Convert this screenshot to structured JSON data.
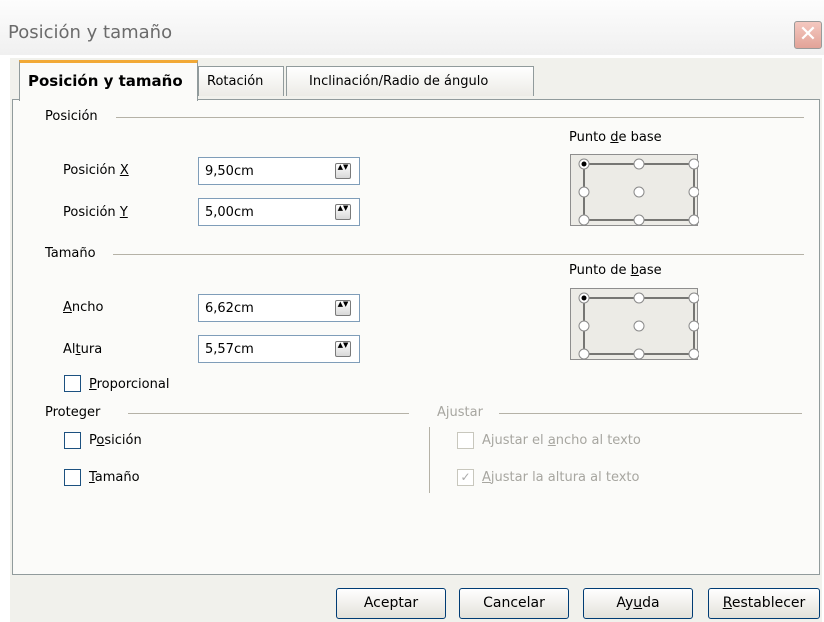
{
  "window": {
    "title": "Posición y tamaño",
    "close_symbol": "✕"
  },
  "tabs": [
    {
      "label": "Posición y tamaño",
      "active": true
    },
    {
      "label": "Rotación",
      "active": false
    },
    {
      "label": "Inclinación/Radio de ángulo",
      "active": false
    }
  ],
  "position": {
    "section_label": "Posición",
    "x_label": "Posición ",
    "x_mnemonic": "X",
    "x_value": "9,50cm",
    "y_label": "Posición ",
    "y_mnemonic": "Y",
    "y_value": "5,00cm",
    "base_point_pre": "Punto ",
    "base_point_mnemonic": "d",
    "base_point_post": "e base",
    "base_point_selected": "top-left"
  },
  "size": {
    "section_label": "Tamaño",
    "width_mnemonic": "A",
    "width_label_rest": "ncho",
    "width_value": "6,62cm",
    "height_pre": "Al",
    "height_mnemonic": "t",
    "height_post": "ura",
    "height_value": "5,57cm",
    "base_point_pre": "Punto de ",
    "base_point_mnemonic": "b",
    "base_point_post": "ase",
    "base_point_selected": "top-left",
    "proportional_mnemonic": "P",
    "proportional_rest": "roporcional",
    "proportional_checked": false
  },
  "protect": {
    "section_label": "Proteger",
    "position_pre": "P",
    "position_mnemonic": "o",
    "position_post": "sición",
    "position_checked": false,
    "size_mnemonic": "T",
    "size_rest": "amaño",
    "size_checked": false
  },
  "adjust": {
    "section_label": "Ajustar",
    "fit_width_pre": "Ajustar el ",
    "fit_width_mnemonic": "a",
    "fit_width_post": "ncho al texto",
    "fit_width_checked": false,
    "fit_height_mnemonic": "A",
    "fit_height_rest": "justar la altura al texto",
    "fit_height_checked": true,
    "check_symbol": "✓"
  },
  "spin_symbol": "▲▼",
  "buttons": {
    "ok": "Aceptar",
    "cancel": "Cancelar",
    "help_pre": "Ay",
    "help_mnemonic": "u",
    "help_post": "da",
    "reset_mnemonic": "R",
    "reset_rest": "establecer"
  }
}
